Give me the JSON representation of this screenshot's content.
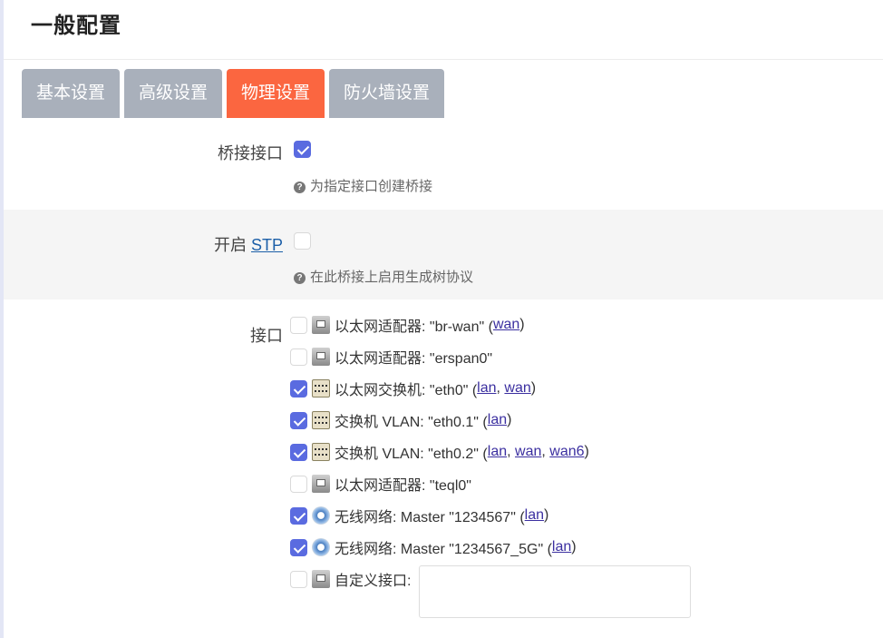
{
  "page": {
    "title": "一般配置"
  },
  "tabs": [
    {
      "label": "基本设置",
      "active": false
    },
    {
      "label": "高级设置",
      "active": false
    },
    {
      "label": "物理设置",
      "active": true
    },
    {
      "label": "防火墙设置",
      "active": false
    }
  ],
  "fields": {
    "bridge": {
      "label": "桥接接口",
      "checked": true,
      "help": "为指定接口创建桥接"
    },
    "stp": {
      "label_prefix": "开启 ",
      "label_link": "STP",
      "checked": false,
      "help": "在此桥接上启用生成树协议"
    },
    "interfaces": {
      "label": "接口",
      "items": [
        {
          "checked": false,
          "icon": "ethernet-adapter-icon",
          "text": "以太网适配器: \"br-wan\" (",
          "networks": [
            "wan"
          ],
          "suffix": ")"
        },
        {
          "checked": false,
          "icon": "ethernet-adapter-icon",
          "text": "以太网适配器: \"erspan0\"",
          "networks": [],
          "suffix": ""
        },
        {
          "checked": true,
          "icon": "switch-icon",
          "text": "以太网交换机: \"eth0\" (",
          "networks": [
            "lan",
            "wan"
          ],
          "suffix": ")"
        },
        {
          "checked": true,
          "icon": "switch-icon",
          "text": "交换机 VLAN: \"eth0.1\" (",
          "networks": [
            "lan"
          ],
          "suffix": ")"
        },
        {
          "checked": true,
          "icon": "switch-icon",
          "text": "交换机 VLAN: \"eth0.2\" (",
          "networks": [
            "lan",
            "wan",
            "wan6"
          ],
          "suffix": ")"
        },
        {
          "checked": false,
          "icon": "ethernet-adapter-icon",
          "text": "以太网适配器: \"teql0\"",
          "networks": [],
          "suffix": ""
        },
        {
          "checked": true,
          "icon": "wireless-icon",
          "text": "无线网络: Master \"1234567\" (",
          "networks": [
            "lan"
          ],
          "suffix": ")"
        },
        {
          "checked": true,
          "icon": "wireless-icon",
          "text": "无线网络: Master \"1234567_5G\" (",
          "networks": [
            "lan"
          ],
          "suffix": ")"
        }
      ],
      "custom": {
        "checked": false,
        "label": "自定义接口:",
        "value": ""
      }
    }
  }
}
